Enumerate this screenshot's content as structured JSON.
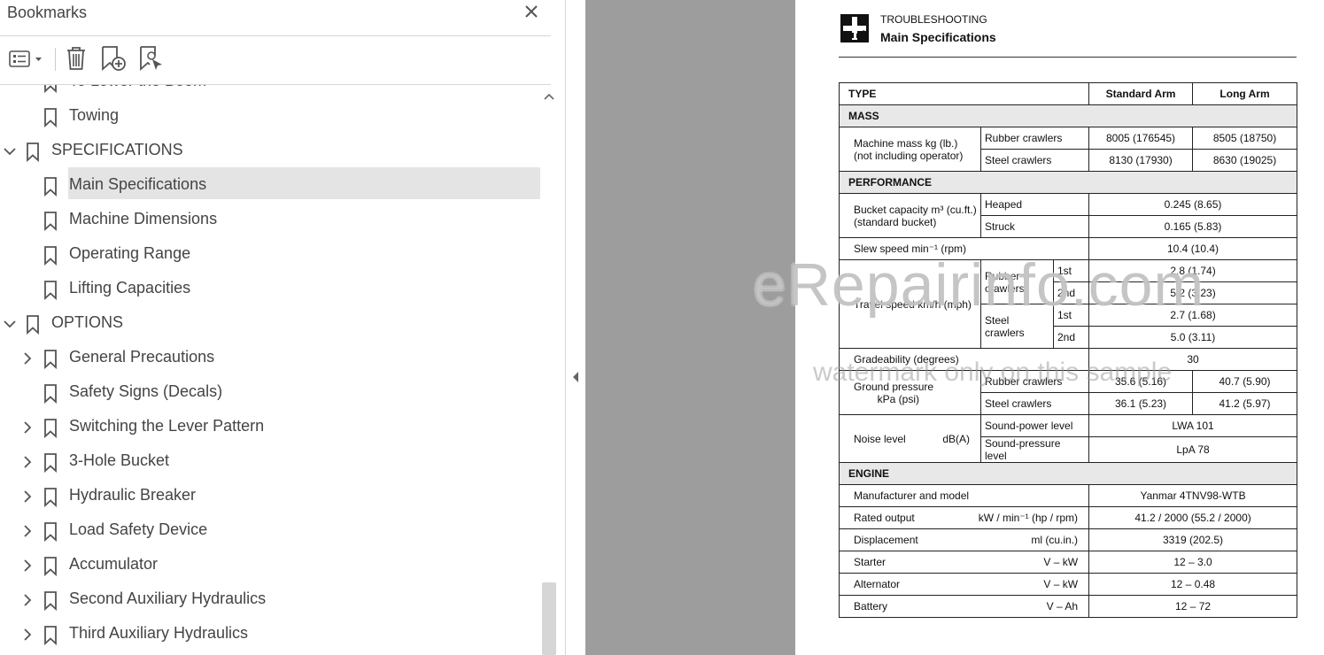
{
  "panel": {
    "title": "Bookmarks",
    "icons": [
      "options-menu-icon",
      "close-icon",
      "delete-bookmark-icon",
      "new-bookmark-icon",
      "find-bookmark-icon"
    ]
  },
  "bookmarks": [
    {
      "label": "To Lower the Boom",
      "level": 1,
      "expandable": false
    },
    {
      "label": "Towing",
      "level": 1,
      "expandable": false
    },
    {
      "label": "SPECIFICATIONS",
      "level": 0,
      "expandable": true,
      "expanded": true
    },
    {
      "label": "Main Specifications",
      "level": 1,
      "expandable": false,
      "selected": true
    },
    {
      "label": "Machine Dimensions",
      "level": 1,
      "expandable": false
    },
    {
      "label": "Operating Range",
      "level": 1,
      "expandable": false
    },
    {
      "label": "Lifting Capacities",
      "level": 1,
      "expandable": false
    },
    {
      "label": "OPTIONS",
      "level": 0,
      "expandable": true,
      "expanded": true
    },
    {
      "label": "General Precautions",
      "level": 1,
      "expandable": true
    },
    {
      "label": "Safety Signs (Decals)",
      "level": 1,
      "expandable": false
    },
    {
      "label": "Switching the Lever Pattern",
      "level": 1,
      "expandable": true
    },
    {
      "label": "3-Hole Bucket",
      "level": 1,
      "expandable": true
    },
    {
      "label": "Hydraulic Breaker",
      "level": 1,
      "expandable": true
    },
    {
      "label": "Load Safety Device",
      "level": 1,
      "expandable": true
    },
    {
      "label": "Accumulator",
      "level": 1,
      "expandable": true
    },
    {
      "label": "Second Auxiliary Hydraulics",
      "level": 1,
      "expandable": true
    },
    {
      "label": "Third Auxiliary Hydraulics",
      "level": 1,
      "expandable": true
    }
  ],
  "doc": {
    "section": "TROUBLESHOOTING",
    "title": "Main Specifications",
    "watermark": "eRepairinfo.com",
    "watermark_sub": "watermark only on this sample",
    "table": {
      "type_label": "TYPE",
      "col_standard": "Standard Arm",
      "col_long": "Long Arm",
      "mass": {
        "section": "MASS",
        "label": "Machine mass  kg (lb.)\n(not including operator)",
        "rows": [
          {
            "name": "Rubber crawlers",
            "standard": "8005 (176545)",
            "long": "8505 (18750)"
          },
          {
            "name": "Steel crawlers",
            "standard": "8130 (17930)",
            "long": "8630 (19025)"
          }
        ]
      },
      "performance": {
        "section": "PERFORMANCE",
        "bucket_label": "Bucket capacity m³ (cu.ft.)\n(standard bucket)",
        "heaped_label": "Heaped",
        "heaped_value": "0.245 (8.65)",
        "struck_label": "Struck",
        "struck_value": "0.165 (5.83)",
        "slew_label": "Slew speed  min⁻¹ (rpm)",
        "slew_value": "10.4 (10.4)",
        "travel_label": "Travel speed km/h (mph)",
        "rubber_label": "Rubber\ncrawlers",
        "steel_label": "Steel\ncrawlers",
        "first": "1st",
        "second": "2nd",
        "travel_rubber_1st": "2.8 (1.74)",
        "travel_rubber_2nd": "5.2 (3.23)",
        "travel_steel_1st": "2.7 (1.68)",
        "travel_steel_2nd": "5.0 (3.11)",
        "grade_label": "Gradeability (degrees)",
        "grade_value": "30",
        "ground_label": "Ground pressure\n        kPa (psi)",
        "ground_rubber_label": "Rubber crawlers",
        "ground_rubber_std": "35.6 (5.16)",
        "ground_rubber_long": "40.7 (5.90)",
        "ground_steel_label": "Steel crawlers",
        "ground_steel_std": "36.1 (5.23)",
        "ground_steel_long": "41.2 (5.97)",
        "noise_label": "Noise level",
        "noise_unit": "dB(A)",
        "sound_power_label": "Sound-power level",
        "sound_power_value": "LWA 101",
        "sound_pressure_label": "Sound-pressure level",
        "sound_pressure_value": "LpA 78"
      },
      "engine": {
        "section": "ENGINE",
        "rows": [
          {
            "name": "Manufacturer and model",
            "unit": "",
            "value": "Yanmar 4TNV98-WTB"
          },
          {
            "name": "Rated output",
            "unit": "kW / min⁻¹ (hp / rpm)",
            "value": "41.2 / 2000 (55.2 / 2000)"
          },
          {
            "name": "Displacement",
            "unit": "ml (cu.in.)",
            "value": "3319 (202.5)"
          },
          {
            "name": "Starter",
            "unit": "V – kW",
            "value": "12 – 3.0"
          },
          {
            "name": "Alternator",
            "unit": "V – kW",
            "value": "12 – 0.48"
          },
          {
            "name": "Battery",
            "unit": "V – Ah",
            "value": "12 – 72"
          }
        ]
      }
    }
  }
}
